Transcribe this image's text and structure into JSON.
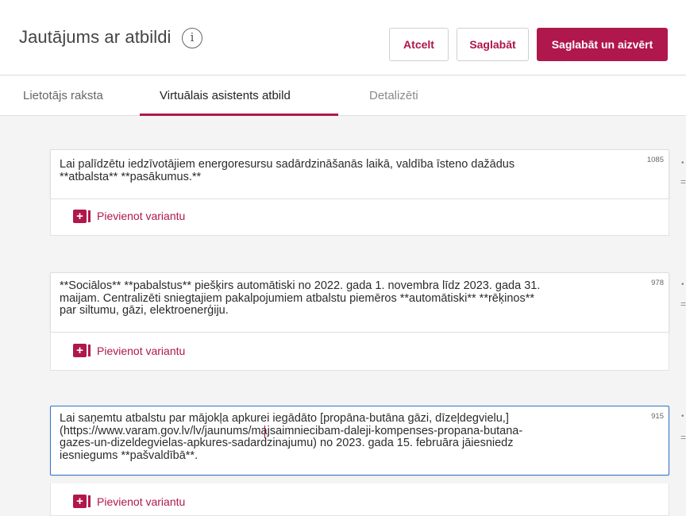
{
  "header": {
    "title": "Jautājums ar atbildi",
    "info_icon": "info-icon",
    "cancel_label": "Atcelt",
    "save_label": "Saglabāt",
    "save_close_label": "Saglabāt un aizvērt"
  },
  "tabs": [
    {
      "label": "Lietotājs raksta"
    },
    {
      "label": "Virtuālais asistents atbild",
      "active": true
    },
    {
      "label": "Detalizēti"
    }
  ],
  "answers": [
    {
      "text": "Lai palīdzētu iedzīvotājiem energoresursu sadārdzināšanās laikā, valdība īsteno dažādus\n**atbalsta** **pasākumus.**",
      "count": "1085",
      "add_label": "Pievienot variantu"
    },
    {
      "text": "**Sociālos** **pabalstus** piešķirs automātiski no 2022. gada 1. novembra līdz 2023. gada 31.\nmaijam. Centralizēti sniegtajiem pakalpojumiem atbalstu piemēros **automātiski** **rēķinos**\npar siltumu, gāzi, elektroenerģiju.",
      "count": "978",
      "add_label": "Pievienot variantu"
    },
    {
      "text": "Lai saņemtu atbalstu par mājokļa apkurei iegādāto [propāna-butāna gāzi, dīzeļdegvielu,]\n(https://www.varam.gov.lv/lv/jaunums/majsaimniecibam-daleji-kompenses-propana-butana-\ngazes-un-dizeldegvielas-apkures-sadardzinajumu) no 2023. gada 15. februāra jāiesniedz\niesniegums **pašvaldībā**.",
      "count": "915",
      "add_label": "Pievienot variantu"
    }
  ],
  "colors": {
    "accent": "#b0174c",
    "focus_border": "#2f73c9"
  }
}
